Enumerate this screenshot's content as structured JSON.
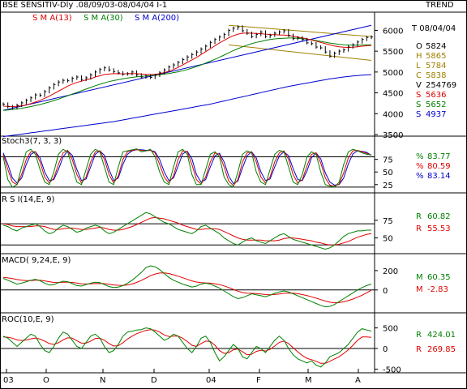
{
  "header": {
    "title": "BSE SENSITIV-Dly .08/09/03-08/04/04 I-1",
    "trend_label": "TREND"
  },
  "price_panel": {
    "ma_labels": [
      {
        "text": "S M A(13)",
        "color": "#e00000"
      },
      {
        "text": "S M A(30)",
        "color": "#008000"
      },
      {
        "text": "S M A(200)",
        "color": "#0000d0"
      }
    ],
    "date_line": "T 08/04/04",
    "stats": [
      {
        "key": "O",
        "value": "5824",
        "color": "#000000"
      },
      {
        "key": "H",
        "value": "5865",
        "color": "#a08000"
      },
      {
        "key": "L",
        "value": "5784",
        "color": "#a08000"
      },
      {
        "key": "C",
        "value": "5838",
        "color": "#a08000"
      },
      {
        "key": "V",
        "value": "254769",
        "color": "#000000"
      },
      {
        "key": "S",
        "value": "5636",
        "color": "#e00000"
      },
      {
        "key": "S",
        "value": "5652",
        "color": "#008000"
      },
      {
        "key": "S",
        "value": "4937",
        "color": "#0000d0"
      }
    ]
  },
  "stoch_panel": {
    "label": "Stoch3(7, 3, 3)",
    "values": [
      {
        "key": "%",
        "value": "83.77",
        "color": "#008000"
      },
      {
        "key": "%",
        "value": "80.59",
        "color": "#e00000"
      },
      {
        "key": "%",
        "value": "83.14",
        "color": "#0000d0"
      }
    ]
  },
  "rsi_panel": {
    "label": "R S I(14,E, 9)",
    "values": [
      {
        "key": "R",
        "value": "60.82",
        "color": "#008000"
      },
      {
        "key": "R",
        "value": "55.53",
        "color": "#e00000"
      }
    ]
  },
  "macd_panel": {
    "label": "MACD( 9,24,E, 9)",
    "values": [
      {
        "key": "M",
        "value": "60.35",
        "color": "#008000"
      },
      {
        "key": "M",
        "value": "-2.83",
        "color": "#e00000"
      }
    ]
  },
  "roc_panel": {
    "label": "ROC(10,E, 9)",
    "values": [
      {
        "key": "R",
        "value": "424.01",
        "color": "#008000"
      },
      {
        "key": "R",
        "value": "269.85",
        "color": "#e00000"
      }
    ]
  },
  "chart_data": [
    {
      "type": "line",
      "name": "price",
      "ylim": [
        3500,
        6300
      ],
      "yticks": [
        3500,
        4000,
        4500,
        5000,
        5500,
        6000
      ],
      "xticks": [
        "03",
        "O",
        "N",
        "D",
        "04",
        "F",
        "M",
        "A"
      ],
      "close": [
        4230,
        4170,
        4140,
        4200,
        4260,
        4320,
        4380,
        4450,
        4440,
        4530,
        4620,
        4700,
        4760,
        4800,
        4790,
        4850,
        4880,
        4820,
        4860,
        4930,
        5000,
        5060,
        5100,
        5050,
        5010,
        4980,
        4950,
        4960,
        5000,
        4930,
        4880,
        4900,
        4870,
        4920,
        4980,
        5050,
        5120,
        5170,
        5230,
        5300,
        5360,
        5420,
        5480,
        5550,
        5620,
        5710,
        5780,
        5840,
        5900,
        6000,
        6050,
        6080,
        5990,
        5930,
        5850,
        5900,
        5960,
        5850,
        5880,
        5930,
        5960,
        5990,
        5880,
        5800,
        5820,
        5780,
        5700,
        5680,
        5600,
        5580,
        5480,
        5380,
        5450,
        5500,
        5530,
        5600,
        5650,
        5720,
        5780,
        5830,
        5840
      ],
      "sma13": [
        4180,
        4175,
        4170,
        4175,
        4190,
        4210,
        4240,
        4280,
        4320,
        4370,
        4420,
        4480,
        4540,
        4600,
        4660,
        4710,
        4750,
        4780,
        4810,
        4840,
        4880,
        4910,
        4940,
        4950,
        4960,
        4960,
        4955,
        4960,
        4965,
        4960,
        4950,
        4945,
        4940,
        4945,
        4960,
        4985,
        5020,
        5060,
        5110,
        5170,
        5230,
        5290,
        5350,
        5420,
        5490,
        5560,
        5630,
        5700,
        5760,
        5820,
        5870,
        5910,
        5930,
        5935,
        5930,
        5925,
        5920,
        5910,
        5900,
        5895,
        5890,
        5885,
        5875,
        5860,
        5840,
        5820,
        5795,
        5770,
        5740,
        5710,
        5680,
        5650,
        5625,
        5605,
        5595,
        5590,
        5595,
        5605,
        5620,
        5630,
        5636
      ],
      "sma30": [
        4080,
        4090,
        4100,
        4115,
        4130,
        4150,
        4170,
        4195,
        4220,
        4250,
        4280,
        4315,
        4350,
        4390,
        4430,
        4470,
        4510,
        4550,
        4590,
        4630,
        4670,
        4705,
        4740,
        4770,
        4795,
        4815,
        4835,
        4855,
        4870,
        4885,
        4895,
        4905,
        4915,
        4925,
        4935,
        4950,
        4965,
        4985,
        5005,
        5030,
        5060,
        5095,
        5130,
        5170,
        5215,
        5260,
        5305,
        5355,
        5405,
        5460,
        5515,
        5560,
        5605,
        5645,
        5680,
        5710,
        5735,
        5760,
        5780,
        5795,
        5805,
        5810,
        5815,
        5815,
        5810,
        5800,
        5790,
        5775,
        5755,
        5735,
        5715,
        5695,
        5680,
        5665,
        5655,
        5648,
        5645,
        5645,
        5648,
        5650,
        5652
      ],
      "sma200": [
        3450,
        3465,
        3480,
        3495,
        3510,
        3525,
        3540,
        3555,
        3570,
        3585,
        3600,
        3615,
        3630,
        3645,
        3660,
        3675,
        3690,
        3705,
        3720,
        3735,
        3750,
        3765,
        3780,
        3795,
        3810,
        3830,
        3850,
        3870,
        3890,
        3910,
        3930,
        3950,
        3970,
        3990,
        4010,
        4030,
        4050,
        4070,
        4090,
        4110,
        4130,
        4150,
        4170,
        4190,
        4210,
        4230,
        4255,
        4280,
        4305,
        4330,
        4355,
        4380,
        4405,
        4430,
        4455,
        4480,
        4505,
        4530,
        4555,
        4580,
        4605,
        4630,
        4655,
        4675,
        4695,
        4715,
        4735,
        4755,
        4775,
        4795,
        4815,
        4835,
        4850,
        4865,
        4880,
        4893,
        4905,
        4915,
        4924,
        4931,
        4937
      ]
    },
    {
      "type": "line",
      "name": "stochastic",
      "ylim": [
        15,
        105
      ],
      "yticks": [
        25,
        50,
        75
      ],
      "k": [
        80,
        35,
        20,
        25,
        60,
        90,
        95,
        85,
        55,
        30,
        25,
        50,
        85,
        95,
        90,
        60,
        30,
        25,
        55,
        85,
        95,
        90,
        60,
        30,
        25,
        60,
        90,
        92,
        94,
        96,
        90,
        92,
        95,
        80,
        50,
        30,
        25,
        60,
        90,
        95,
        85,
        45,
        25,
        25,
        55,
        85,
        90,
        80,
        40,
        25,
        20,
        50,
        85,
        92,
        88,
        50,
        30,
        25,
        55,
        85,
        93,
        90,
        60,
        30,
        25,
        45,
        80,
        90,
        85,
        50,
        25,
        22,
        20,
        30,
        65,
        90,
        95,
        92,
        88,
        85,
        84
      ],
      "d": [
        85,
        55,
        30,
        25,
        45,
        75,
        90,
        90,
        70,
        40,
        28,
        38,
        65,
        88,
        93,
        75,
        45,
        28,
        40,
        70,
        90,
        92,
        75,
        45,
        28,
        42,
        75,
        90,
        93,
        94,
        93,
        92,
        93,
        88,
        65,
        40,
        28,
        42,
        75,
        92,
        90,
        65,
        35,
        26,
        40,
        70,
        88,
        85,
        60,
        32,
        23,
        35,
        70,
        88,
        90,
        70,
        40,
        28,
        40,
        70,
        88,
        92,
        75,
        45,
        28,
        35,
        62,
        85,
        88,
        68,
        38,
        24,
        22,
        26,
        48,
        78,
        92,
        93,
        90,
        87,
        83
      ],
      "slow": [
        88,
        65,
        38,
        28,
        38,
        65,
        85,
        90,
        78,
        50,
        33,
        35,
        55,
        80,
        92,
        83,
        55,
        33,
        36,
        60,
        85,
        92,
        83,
        55,
        33,
        38,
        65,
        85,
        92,
        94,
        94,
        93,
        93,
        90,
        75,
        50,
        33,
        38,
        62,
        86,
        91,
        76,
        45,
        30,
        35,
        60,
        82,
        87,
        70,
        42,
        27,
        32,
        58,
        82,
        90,
        78,
        50,
        33,
        36,
        60,
        82,
        90,
        82,
        57,
        35,
        33,
        52,
        78,
        88,
        76,
        48,
        30,
        24,
        25,
        38,
        66,
        86,
        92,
        91,
        89,
        83
      ]
    },
    {
      "type": "line",
      "name": "rsi",
      "ylim": [
        30,
        100
      ],
      "yticks": [
        50,
        75
      ],
      "rsi": [
        68,
        66,
        62,
        60,
        64,
        66,
        68,
        70,
        66,
        60,
        56,
        58,
        64,
        68,
        66,
        62,
        58,
        60,
        64,
        66,
        68,
        66,
        60,
        56,
        58,
        62,
        66,
        70,
        74,
        78,
        82,
        86,
        84,
        80,
        76,
        72,
        70,
        66,
        62,
        60,
        58,
        56,
        60,
        66,
        68,
        64,
        60,
        56,
        50,
        46,
        42,
        40,
        44,
        48,
        50,
        46,
        44,
        42,
        46,
        50,
        54,
        56,
        52,
        48,
        46,
        44,
        42,
        40,
        38,
        36,
        34,
        36,
        40,
        46,
        52,
        56,
        58,
        60,
        60,
        61,
        61
      ],
      "signal": [
        70,
        69,
        67,
        66,
        66,
        66,
        66,
        67,
        67,
        66,
        64,
        62,
        62,
        63,
        64,
        64,
        63,
        62,
        62,
        63,
        64,
        65,
        64,
        62,
        61,
        61,
        62,
        64,
        66,
        69,
        72,
        75,
        78,
        79,
        78,
        77,
        75,
        73,
        71,
        68,
        66,
        64,
        62,
        62,
        63,
        63,
        63,
        62,
        59,
        56,
        53,
        50,
        48,
        47,
        47,
        47,
        47,
        46,
        46,
        46,
        47,
        49,
        50,
        50,
        49,
        48,
        47,
        46,
        44,
        43,
        41,
        40,
        40,
        41,
        43,
        45,
        48,
        51,
        53,
        55,
        56
      ]
    },
    {
      "type": "line",
      "name": "macd",
      "ylim": [
        -220,
        300
      ],
      "yticks": [
        0,
        200
      ],
      "macd": [
        120,
        100,
        80,
        60,
        70,
        85,
        100,
        110,
        95,
        70,
        50,
        55,
        75,
        90,
        85,
        65,
        45,
        40,
        55,
        70,
        80,
        75,
        55,
        35,
        25,
        30,
        45,
        70,
        100,
        140,
        180,
        230,
        250,
        240,
        210,
        170,
        130,
        100,
        80,
        60,
        45,
        30,
        40,
        60,
        70,
        60,
        40,
        20,
        -10,
        -40,
        -70,
        -90,
        -80,
        -60,
        -40,
        -50,
        -60,
        -70,
        -55,
        -35,
        -20,
        -10,
        -20,
        -40,
        -60,
        -80,
        -100,
        -120,
        -140,
        -160,
        -175,
        -170,
        -150,
        -120,
        -90,
        -60,
        -30,
        0,
        25,
        45,
        60
      ],
      "signal": [
        130,
        125,
        118,
        108,
        100,
        96,
        97,
        100,
        100,
        94,
        85,
        78,
        77,
        80,
        81,
        78,
        71,
        64,
        62,
        63,
        66,
        68,
        65,
        59,
        52,
        48,
        47,
        52,
        62,
        78,
        98,
        122,
        147,
        165,
        175,
        176,
        170,
        157,
        142,
        126,
        110,
        94,
        82,
        75,
        73,
        70,
        64,
        55,
        42,
        25,
        6,
        -13,
        -27,
        -34,
        -35,
        -38,
        -42,
        -48,
        -50,
        -47,
        -42,
        -35,
        -32,
        -34,
        -39,
        -48,
        -58,
        -71,
        -85,
        -100,
        -115,
        -127,
        -133,
        -131,
        -123,
        -110,
        -94,
        -75,
        -55,
        -30,
        -3
      ]
    },
    {
      "type": "line",
      "name": "roc",
      "ylim": [
        -550,
        650
      ],
      "yticks": [
        -500,
        0,
        500
      ],
      "roc": [
        300,
        250,
        150,
        50,
        150,
        250,
        350,
        300,
        100,
        -50,
        -100,
        50,
        250,
        400,
        350,
        200,
        50,
        0,
        150,
        300,
        350,
        250,
        50,
        -100,
        -50,
        100,
        300,
        400,
        420,
        450,
        460,
        500,
        480,
        400,
        300,
        200,
        250,
        350,
        300,
        150,
        0,
        -100,
        50,
        250,
        300,
        150,
        -100,
        -300,
        -200,
        -50,
        100,
        0,
        -200,
        -250,
        -100,
        50,
        0,
        -100,
        50,
        200,
        300,
        200,
        0,
        -150,
        -250,
        -300,
        -350,
        -300,
        -400,
        -450,
        -350,
        -200,
        -150,
        -100,
        0,
        100,
        250,
        400,
        480,
        450,
        424
      ],
      "signal": [
        280,
        275,
        250,
        210,
        195,
        205,
        235,
        255,
        230,
        180,
        120,
        100,
        140,
        210,
        260,
        250,
        190,
        130,
        130,
        180,
        240,
        250,
        200,
        120,
        60,
        70,
        140,
        230,
        300,
        360,
        400,
        440,
        460,
        445,
        400,
        330,
        290,
        300,
        300,
        250,
        170,
        80,
        50,
        120,
        180,
        170,
        80,
        -50,
        -120,
        -100,
        -30,
        -10,
        -80,
        -150,
        -140,
        -70,
        -40,
        -60,
        -20,
        60,
        150,
        180,
        120,
        20,
        -80,
        -170,
        -240,
        -270,
        -310,
        -360,
        -360,
        -310,
        -250,
        -200,
        -120,
        -30,
        80,
        200,
        280,
        280,
        270
      ]
    }
  ]
}
